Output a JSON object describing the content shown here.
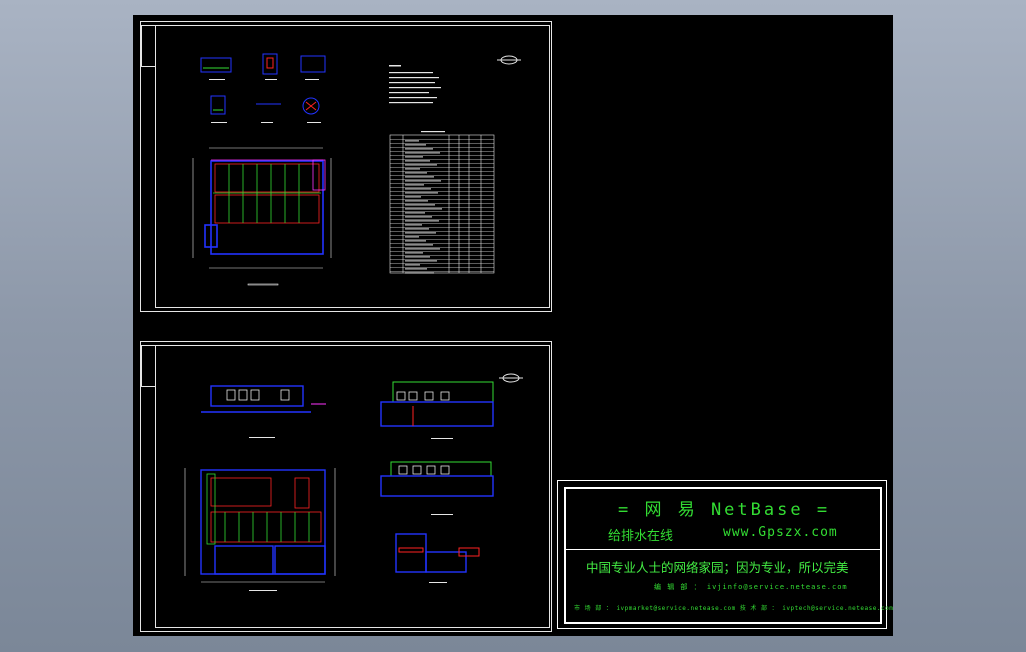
{
  "netbase": {
    "title": "=  网 易  NetBase  =",
    "subtitle_cn": "给排水在线",
    "subtitle_url": "www.Gpszx.com",
    "slogan": "中国专业人士的网络家园；因为专业，所以完美",
    "mail_line": "编 辑 部 ： ivjinfo@service.netease.com",
    "bottom_line": "市 场 部 ： ivpmarket@service.netease.com   技 术 部 ： ivptech@service.netease.com"
  },
  "colors": {
    "canvas_bg": "#000000",
    "app_bg": "#8d98a9",
    "sheet_border": "#e6e6e6",
    "accent_green": "#33dd33",
    "drawing_blue": "#2233ff",
    "drawing_red": "#ff2222",
    "drawing_magenta": "#ff33ff"
  }
}
